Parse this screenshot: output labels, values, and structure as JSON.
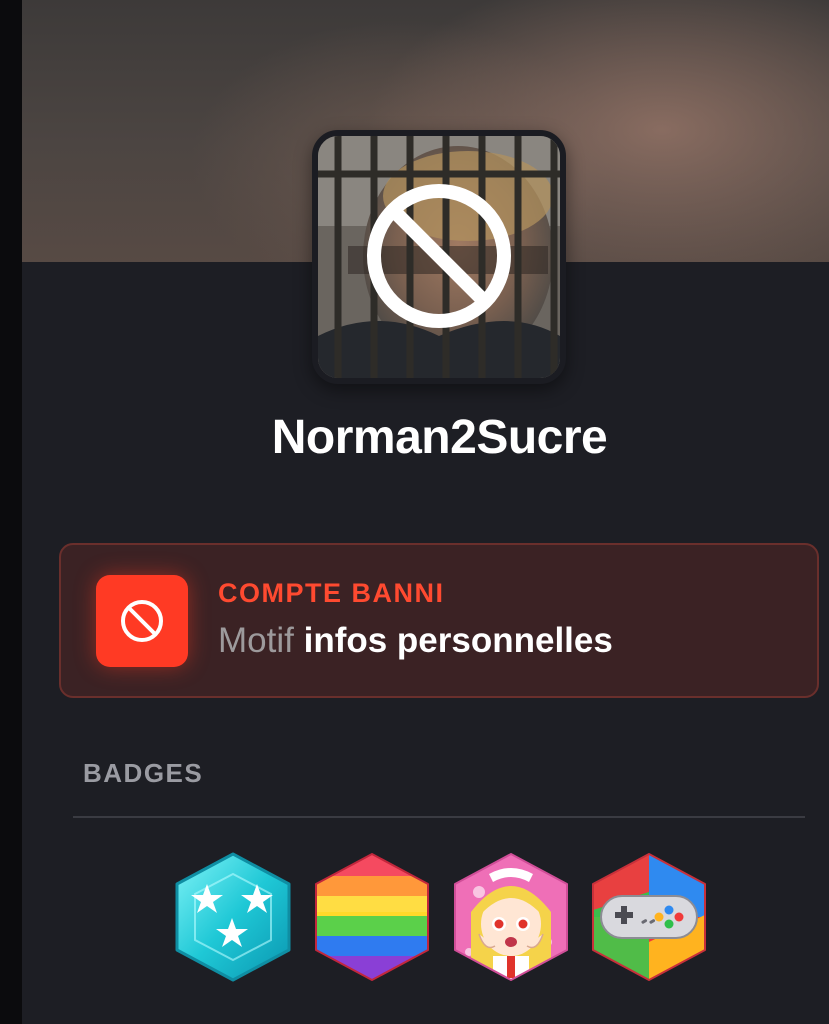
{
  "profile": {
    "username": "Norman2Sucre",
    "avatar_overlay_icon": "no-entry-icon"
  },
  "ban": {
    "title": "COMPTE BANNI",
    "reason_label": "Motif",
    "reason_value": "infos personnelles",
    "icon": "no-entry-icon",
    "accent_color": "#ff3a24"
  },
  "badges": {
    "title": "BADGES",
    "items": [
      {
        "icon": "stars-badge-icon"
      },
      {
        "icon": "rainbow-badge-icon"
      },
      {
        "icon": "anime-girl-badge-icon"
      },
      {
        "icon": "gamepad-badge-icon"
      }
    ]
  }
}
